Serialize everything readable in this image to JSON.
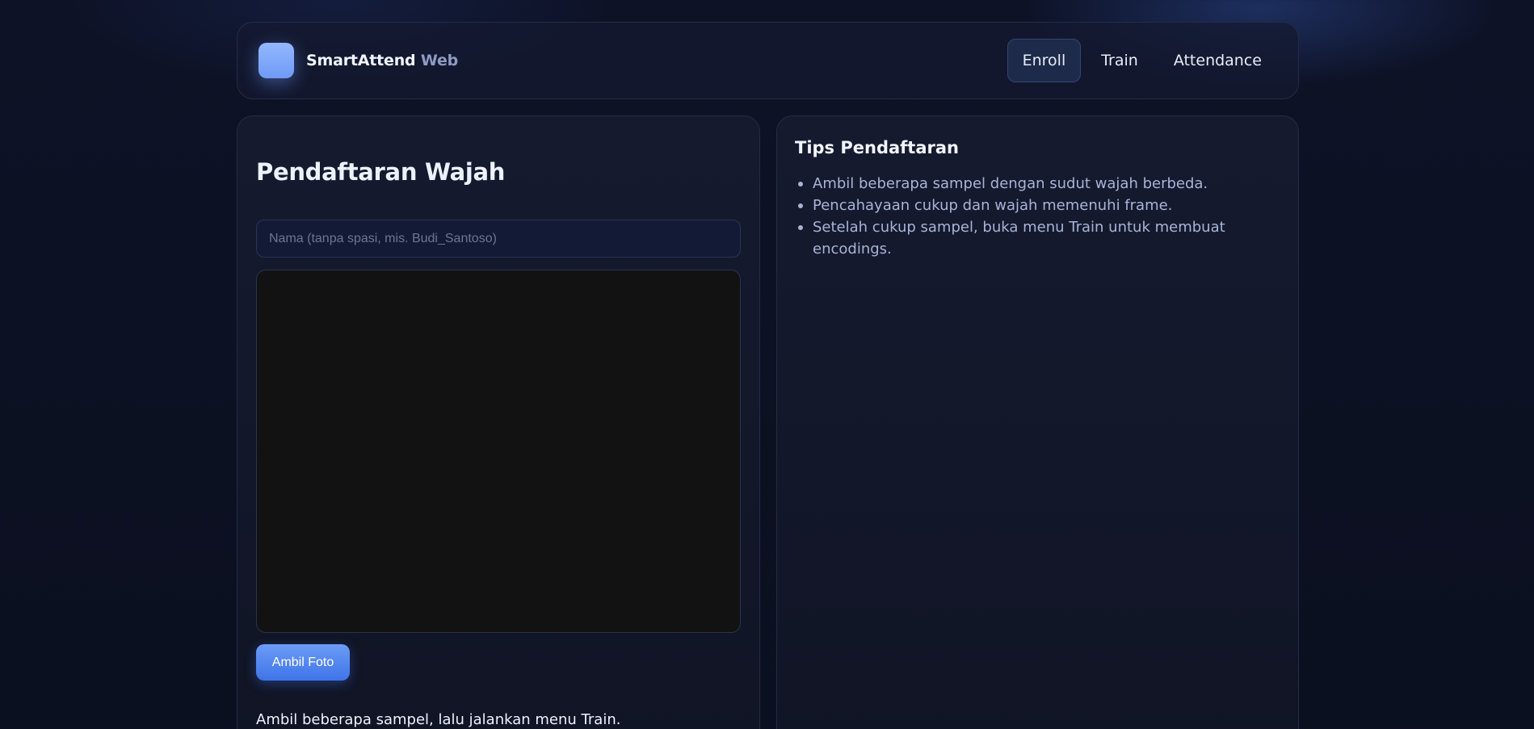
{
  "app": {
    "brand_name": "SmartAttend",
    "brand_suffix": "Web",
    "accent_color": "#6f9af5"
  },
  "nav": {
    "items": [
      {
        "label": "Enroll",
        "active": true
      },
      {
        "label": "Train",
        "active": false
      },
      {
        "label": "Attendance",
        "active": false
      }
    ]
  },
  "enroll": {
    "title": "Pendaftaran Wajah",
    "name_placeholder": "Nama (tanpa spasi, mis. Budi_Santoso)",
    "name_value": "",
    "capture_button": "Ambil Foto",
    "helper_text": "Ambil beberapa sampel, lalu jalankan menu Train."
  },
  "tips": {
    "title": "Tips Pendaftaran",
    "items": [
      "Ambil beberapa sampel dengan sudut wajah berbeda.",
      "Pencahayaan cukup dan wajah memenuhi frame.",
      "Setelah cukup sampel, buka menu Train untuk membuat encodings."
    ]
  }
}
